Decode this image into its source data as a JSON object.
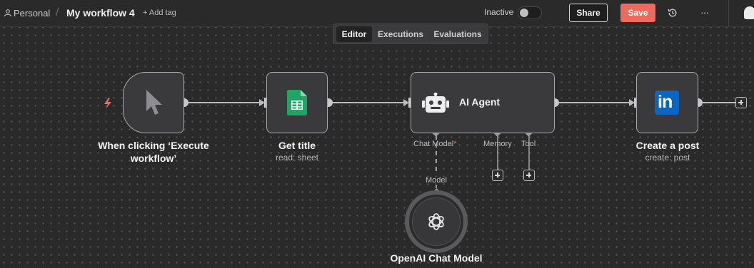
{
  "header": {
    "breadcrumb_personal": "Personal",
    "separator": "/",
    "workflow_title": "My workflow 4",
    "add_tag": "+ Add tag",
    "status_label": "Inactive",
    "share": "Share",
    "save": "Save",
    "more": "···"
  },
  "tabs": [
    {
      "label": "Editor",
      "active": true
    },
    {
      "label": "Executions",
      "active": false
    },
    {
      "label": "Evaluations",
      "active": false
    }
  ],
  "nodes": {
    "trigger": {
      "title_line1": "When clicking ‘Execute",
      "title_line2": "workflow’"
    },
    "sheet": {
      "title": "Get title",
      "subtitle": "read: sheet"
    },
    "agent": {
      "title": "AI Agent",
      "ports": {
        "chat_model": "Chat Model",
        "required_mark": "*",
        "memory": "Memory",
        "tool": "Tool"
      }
    },
    "linkedin": {
      "title": "Create a post",
      "subtitle": "create: post",
      "logo_text": "in"
    },
    "openai": {
      "title": "OpenAI Chat Model",
      "port_label": "Model"
    }
  },
  "colors": {
    "accent": "#ef6a5c",
    "sheets_green": "#1fa463",
    "linkedin_blue": "#0a66c2",
    "node_bg": "#3a3a3c",
    "connector": "#bdbdbd"
  }
}
